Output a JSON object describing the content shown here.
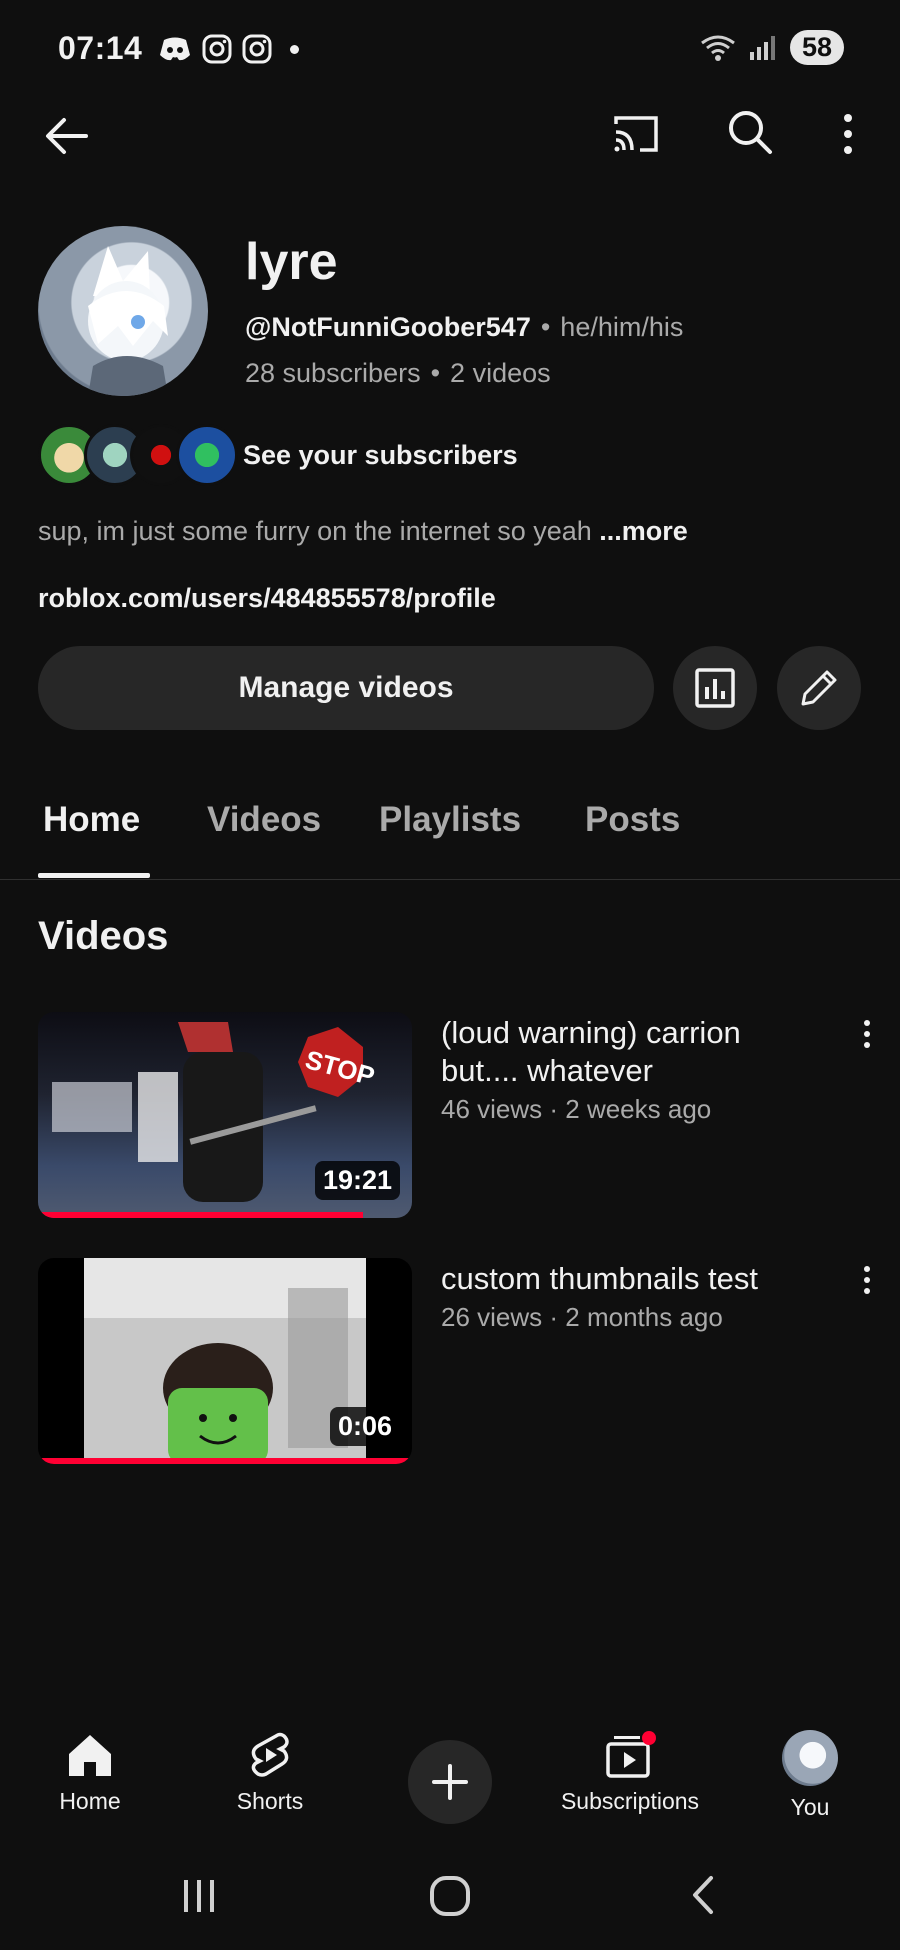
{
  "status_bar": {
    "time": "07:14",
    "battery": "58"
  },
  "top_bar": {
    "back_icon": "arrow-left-icon",
    "cast_icon": "cast-icon",
    "search_icon": "search-icon",
    "more_icon": "more-vertical-icon"
  },
  "channel": {
    "name": "lyre",
    "handle": "@NotFunniGoober547",
    "pronouns": "he/him/his",
    "subscribers": "28 subscribers",
    "videos_count": "2 videos",
    "see_subscribers": "See your subscribers",
    "description": "sup, im just some furry on the internet so yeah",
    "more": "...more",
    "link": "roblox.com/users/484855578/profile"
  },
  "actions": {
    "manage_videos": "Manage videos"
  },
  "tabs": [
    {
      "label": "Home",
      "active": true
    },
    {
      "label": "Videos",
      "active": false
    },
    {
      "label": "Playlists",
      "active": false
    },
    {
      "label": "Posts",
      "active": false
    }
  ],
  "section_title": "Videos",
  "videos": [
    {
      "title": "(loud warning) carrion but.... whatever",
      "meta": "46 views · 2 weeks ago",
      "duration": "19:21",
      "watched_fraction": 0.87
    },
    {
      "title": "custom thumbnails test",
      "meta": "26 views · 2 months ago",
      "duration": "0:06",
      "watched_fraction": 1.0
    }
  ],
  "bottom_nav": [
    {
      "label": "Home",
      "icon": "home-icon"
    },
    {
      "label": "Shorts",
      "icon": "shorts-icon"
    },
    {
      "label": "Subscriptions",
      "icon": "subscriptions-icon"
    },
    {
      "label": "You",
      "icon": "avatar"
    }
  ],
  "colors": {
    "background": "#0f0f0f",
    "surface": "#272727",
    "accent_red": "#ff0033"
  }
}
